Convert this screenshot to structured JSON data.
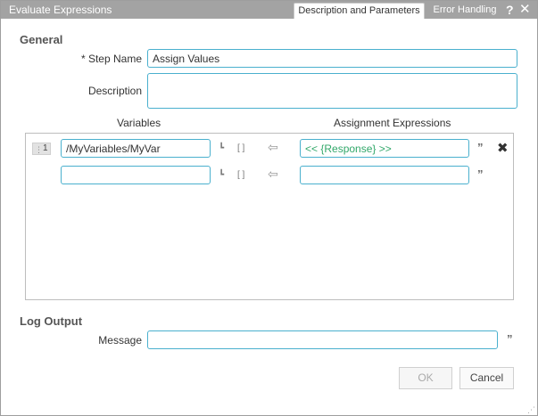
{
  "window": {
    "title": "Evaluate Expressions"
  },
  "tabs": [
    {
      "label": "Description and Parameters",
      "active": true
    },
    {
      "label": "Error Handling",
      "active": false
    }
  ],
  "titlebar_icons": {
    "help": "?",
    "close": "✕"
  },
  "general": {
    "heading": "General",
    "step_name_label": "* Step Name",
    "step_name_value": "Assign Values",
    "description_label": "Description",
    "description_value": ""
  },
  "grid": {
    "variables_header": "Variables",
    "expressions_header": "Assignment Expressions",
    "rows": [
      {
        "row_number": "1",
        "variable": "/MyVariables/MyVar",
        "expression": "<< {Response} >>"
      },
      {
        "row_number": "",
        "variable": "",
        "expression": ""
      }
    ]
  },
  "log_output": {
    "heading": "Log Output",
    "message_label": "Message",
    "message_value": ""
  },
  "buttons": {
    "ok": "OK",
    "cancel": "Cancel"
  },
  "colors": {
    "accent": "#4ab0ce",
    "titlebar": "#a3a3a3",
    "expression_text": "#32a86a"
  }
}
